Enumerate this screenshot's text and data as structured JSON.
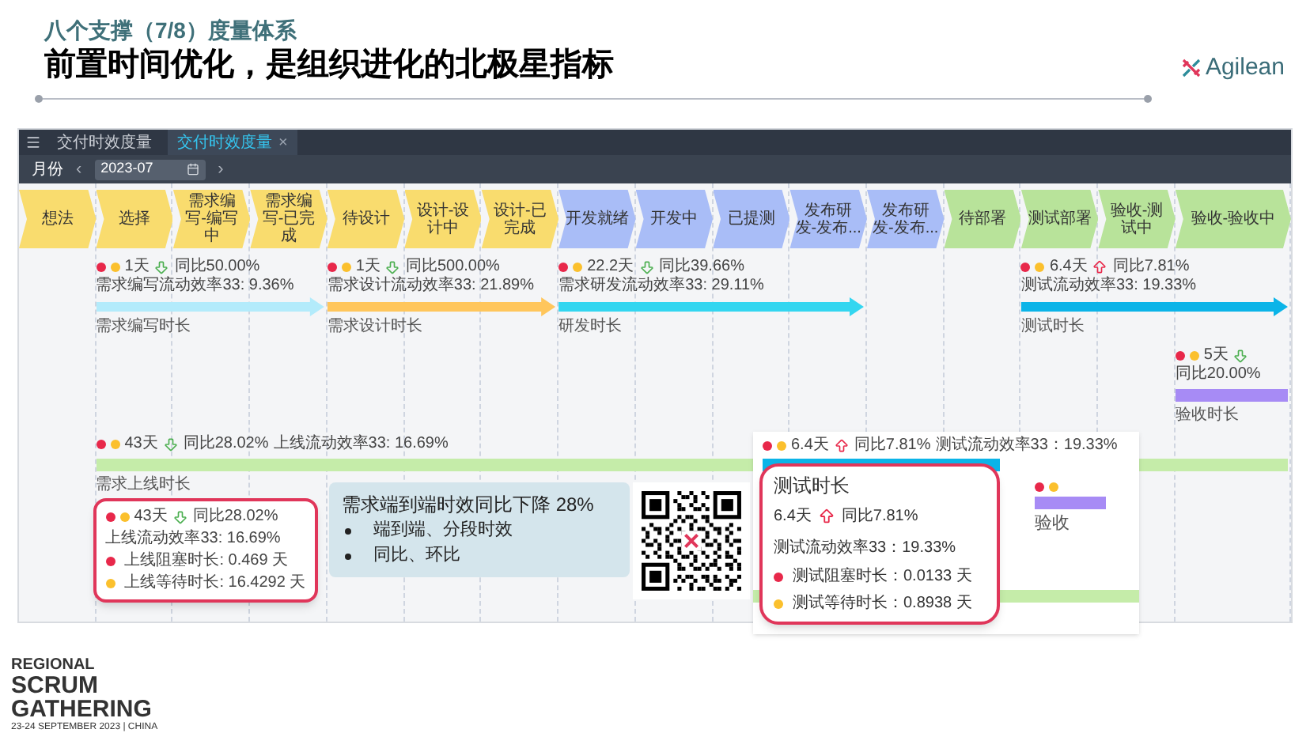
{
  "header": {
    "subtitle": "八个支撑（7/8）度量体系",
    "title": "前置时间优化，是组织进化的北极星指标",
    "logo_text": "Agilean"
  },
  "app": {
    "tabs": [
      {
        "label": "交付时效度量",
        "selected": false
      },
      {
        "label": "交付时效度量",
        "selected": true,
        "close": "×"
      }
    ],
    "filter": {
      "label": "月份",
      "prev": "‹",
      "value": "2023-07",
      "next": "›"
    },
    "stages": [
      {
        "label": "想法",
        "color": "#f9dc6e"
      },
      {
        "label": "选择",
        "color": "#f9dc6e"
      },
      {
        "label": "需求编写-编写中",
        "color": "#f9dc6e"
      },
      {
        "label": "需求编写-已完成",
        "color": "#f9dc6e"
      },
      {
        "label": "待设计",
        "color": "#f9dc6e"
      },
      {
        "label": "设计-设计中",
        "color": "#f9dc6e"
      },
      {
        "label": "设计-已完成",
        "color": "#f9dc6e"
      },
      {
        "label": "开发就绪",
        "color": "#a9bdf7"
      },
      {
        "label": "开发中",
        "color": "#a9bdf7"
      },
      {
        "label": "已提测",
        "color": "#a9bdf7"
      },
      {
        "label": "发布研发-发布...",
        "color": "#a9bdf7"
      },
      {
        "label": "发布研发-发布...",
        "color": "#a9bdf7"
      },
      {
        "label": "待部署",
        "color": "#b8e39a"
      },
      {
        "label": "测试部署",
        "color": "#b8e39a"
      },
      {
        "label": "验收-测试中",
        "color": "#b8e39a"
      },
      {
        "label": "验收-验收中",
        "color": "#b8e39a"
      }
    ],
    "bars": [
      {
        "kind": "arrow",
        "label": "需求编写时长",
        "color": "#b3ebfb",
        "stats": {
          "days": "1天",
          "rising": false,
          "change": "同比50.00%",
          "efficiency": "需求编写流动效率33: 9.36%"
        }
      },
      {
        "kind": "arrow",
        "label": "需求设计时长",
        "color": "#ffc65c",
        "stats": {
          "days": "1天",
          "rising": false,
          "change": "同比500.00%",
          "efficiency": "需求设计流动效率33: 21.89%"
        }
      },
      {
        "kind": "arrow",
        "label": "研发时长",
        "color": "#33d6f0",
        "stats": {
          "days": "22.2天",
          "rising": false,
          "change": "同比39.66%",
          "efficiency": "需求研发流动效率33: 29.11%"
        }
      },
      {
        "kind": "arrow",
        "label": "测试时长",
        "color": "#0bb4e8",
        "stats": {
          "days": "6.4天",
          "rising": true,
          "change": "同比7.81%",
          "efficiency": "测试流动效率33: 19.33%"
        }
      },
      {
        "kind": "plain",
        "label": "验收时长",
        "color": "#a78bf5",
        "stats": {
          "days": "5天",
          "rising": false,
          "change": "同比20.00%"
        }
      },
      {
        "kind": "plain",
        "label": "需求上线时长",
        "color": "#c5eca9",
        "stats": {
          "days": "43天",
          "rising": false,
          "change": "同比28.02%",
          "efficiency": "上线流动效率33: 16.69%"
        }
      }
    ],
    "tooltip": {
      "days": "43天",
      "rising": false,
      "change": "同比28.02%",
      "efficiency": "上线流动效率33: 16.69%",
      "items": [
        {
          "label": "上线阻塞时长: 0.469 天",
          "color": "#e8284a"
        },
        {
          "label": "上线等待时长: 16.4292 天",
          "color": "#fbc02d"
        }
      ]
    }
  },
  "callout": {
    "headline": "需求端到端时效同比下降 28%",
    "bullets": [
      "端到端、分段时效",
      "同比、环比"
    ]
  },
  "zoom_inset": {
    "stats": {
      "days": "6.4天",
      "rising": true,
      "change": "同比7.81%",
      "efficiency": "测试流动效率33：19.33%"
    },
    "tooltip": {
      "title": "测试时长",
      "days": "6.4天",
      "rising": true,
      "change": "同比7.81%",
      "efficiency": "测试流动效率33：19.33%",
      "items": [
        {
          "label": "测试阻塞时长：0.0133 天",
          "color": "#e8284a"
        },
        {
          "label": "测试等待时长：0.8938 天",
          "color": "#fbc02d"
        }
      ]
    },
    "partial_label": "验收"
  },
  "footer": {
    "line1": "REGIONAL",
    "line2": "SCRUM",
    "line3": "GATHERING",
    "line4": "23-24 SEPTEMBER 2023 | CHINA"
  }
}
